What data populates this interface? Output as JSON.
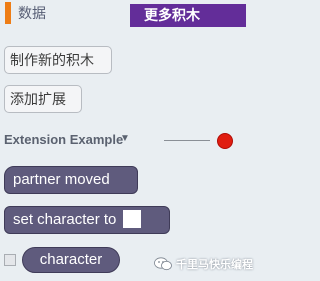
{
  "categories": {
    "data_label": "数据",
    "more_blocks_label": "更多积木",
    "data_color": "#ee7d16",
    "more_blocks_color": "#632d99"
  },
  "buttons": {
    "make_block": "制作新的积木",
    "add_extension": "添加扩展"
  },
  "extension": {
    "title": "Extension Example",
    "status_color": "#e01d10"
  },
  "blocks": {
    "hat_label": "partner moved",
    "command_label": "set character to",
    "reporter_label": "character",
    "block_color": "#5f5b7d"
  },
  "watermark": {
    "text": "千里马快乐编程"
  }
}
